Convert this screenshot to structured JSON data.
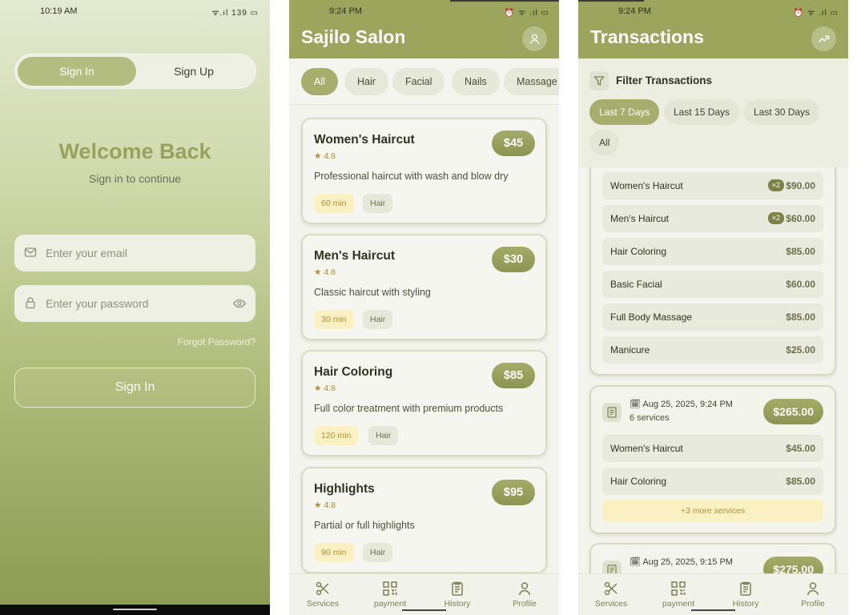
{
  "signin": {
    "status_time": "10:19 AM",
    "status_icons": "ᯤ.ıl 139 ▭",
    "tabs": [
      "Sign In",
      "Sign Up"
    ],
    "title": "Welcome Back",
    "subtitle": "Sign in to continue",
    "email_placeholder": "Enter your email",
    "password_placeholder": "Enter your password",
    "forgot": "Forgot Password?",
    "button": "Sign In"
  },
  "services": {
    "status_time": "9:24 PM",
    "status_icons": "⏰ ᯤ .ıl ▭",
    "title": "Sajilo Salon",
    "categories": [
      "All",
      "Hair",
      "Facial",
      "Nails",
      "Massage"
    ],
    "items": [
      {
        "name": "Women's Haircut",
        "rating": "4.8",
        "price": "$45",
        "description": "Professional haircut with wash and blow dry",
        "duration": "60 min",
        "category": "Hair"
      },
      {
        "name": "Men's Haircut",
        "rating": "4.8",
        "price": "$30",
        "description": "Classic haircut with styling",
        "duration": "30 min",
        "category": "Hair"
      },
      {
        "name": "Hair Coloring",
        "rating": "4.8",
        "price": "$85",
        "description": "Full color treatment with premium products",
        "duration": "120 min",
        "category": "Hair"
      },
      {
        "name": "Highlights",
        "rating": "4.8",
        "price": "$95",
        "description": "Partial or full highlights",
        "duration": "90 min",
        "category": "Hair"
      }
    ]
  },
  "transactions": {
    "status_time": "9:24 PM",
    "status_icons": "⏰ ᯤ .ıl ▭",
    "title": "Transactions",
    "filter_label": "Filter Transactions",
    "filters": [
      "Last 7 Days",
      "Last 15 Days",
      "Last 30 Days",
      "All"
    ],
    "first_card_rows": [
      {
        "name": "Women's Haircut",
        "qty": "×2",
        "price": "$90.00"
      },
      {
        "name": "Men's Haircut",
        "qty": "×2",
        "price": "$60.00"
      },
      {
        "name": "Hair Coloring",
        "qty": "",
        "price": "$85.00"
      },
      {
        "name": "Basic Facial",
        "qty": "",
        "price": "$60.00"
      },
      {
        "name": "Full Body Massage",
        "qty": "",
        "price": "$85.00"
      },
      {
        "name": "Manicure",
        "qty": "",
        "price": "$25.00"
      }
    ],
    "second_card": {
      "date": "Aug 25, 2025, 9:24 PM",
      "count": "6 services",
      "total": "$265.00",
      "rows": [
        {
          "name": "Women's Haircut",
          "price": "$45.00"
        },
        {
          "name": "Hair Coloring",
          "price": "$85.00"
        }
      ],
      "more": "+3 more services"
    },
    "third_card": {
      "date": "Aug 25, 2025, 9:15 PM",
      "total": "$275.00"
    }
  },
  "bottom_nav": [
    "Services",
    "payment",
    "History",
    "Profile"
  ],
  "colors": {
    "brand": "#9ba55c",
    "brand_dark": "#8b9552",
    "accent_yellow": "#fbf0c2",
    "chip": "#e6e8d9"
  }
}
